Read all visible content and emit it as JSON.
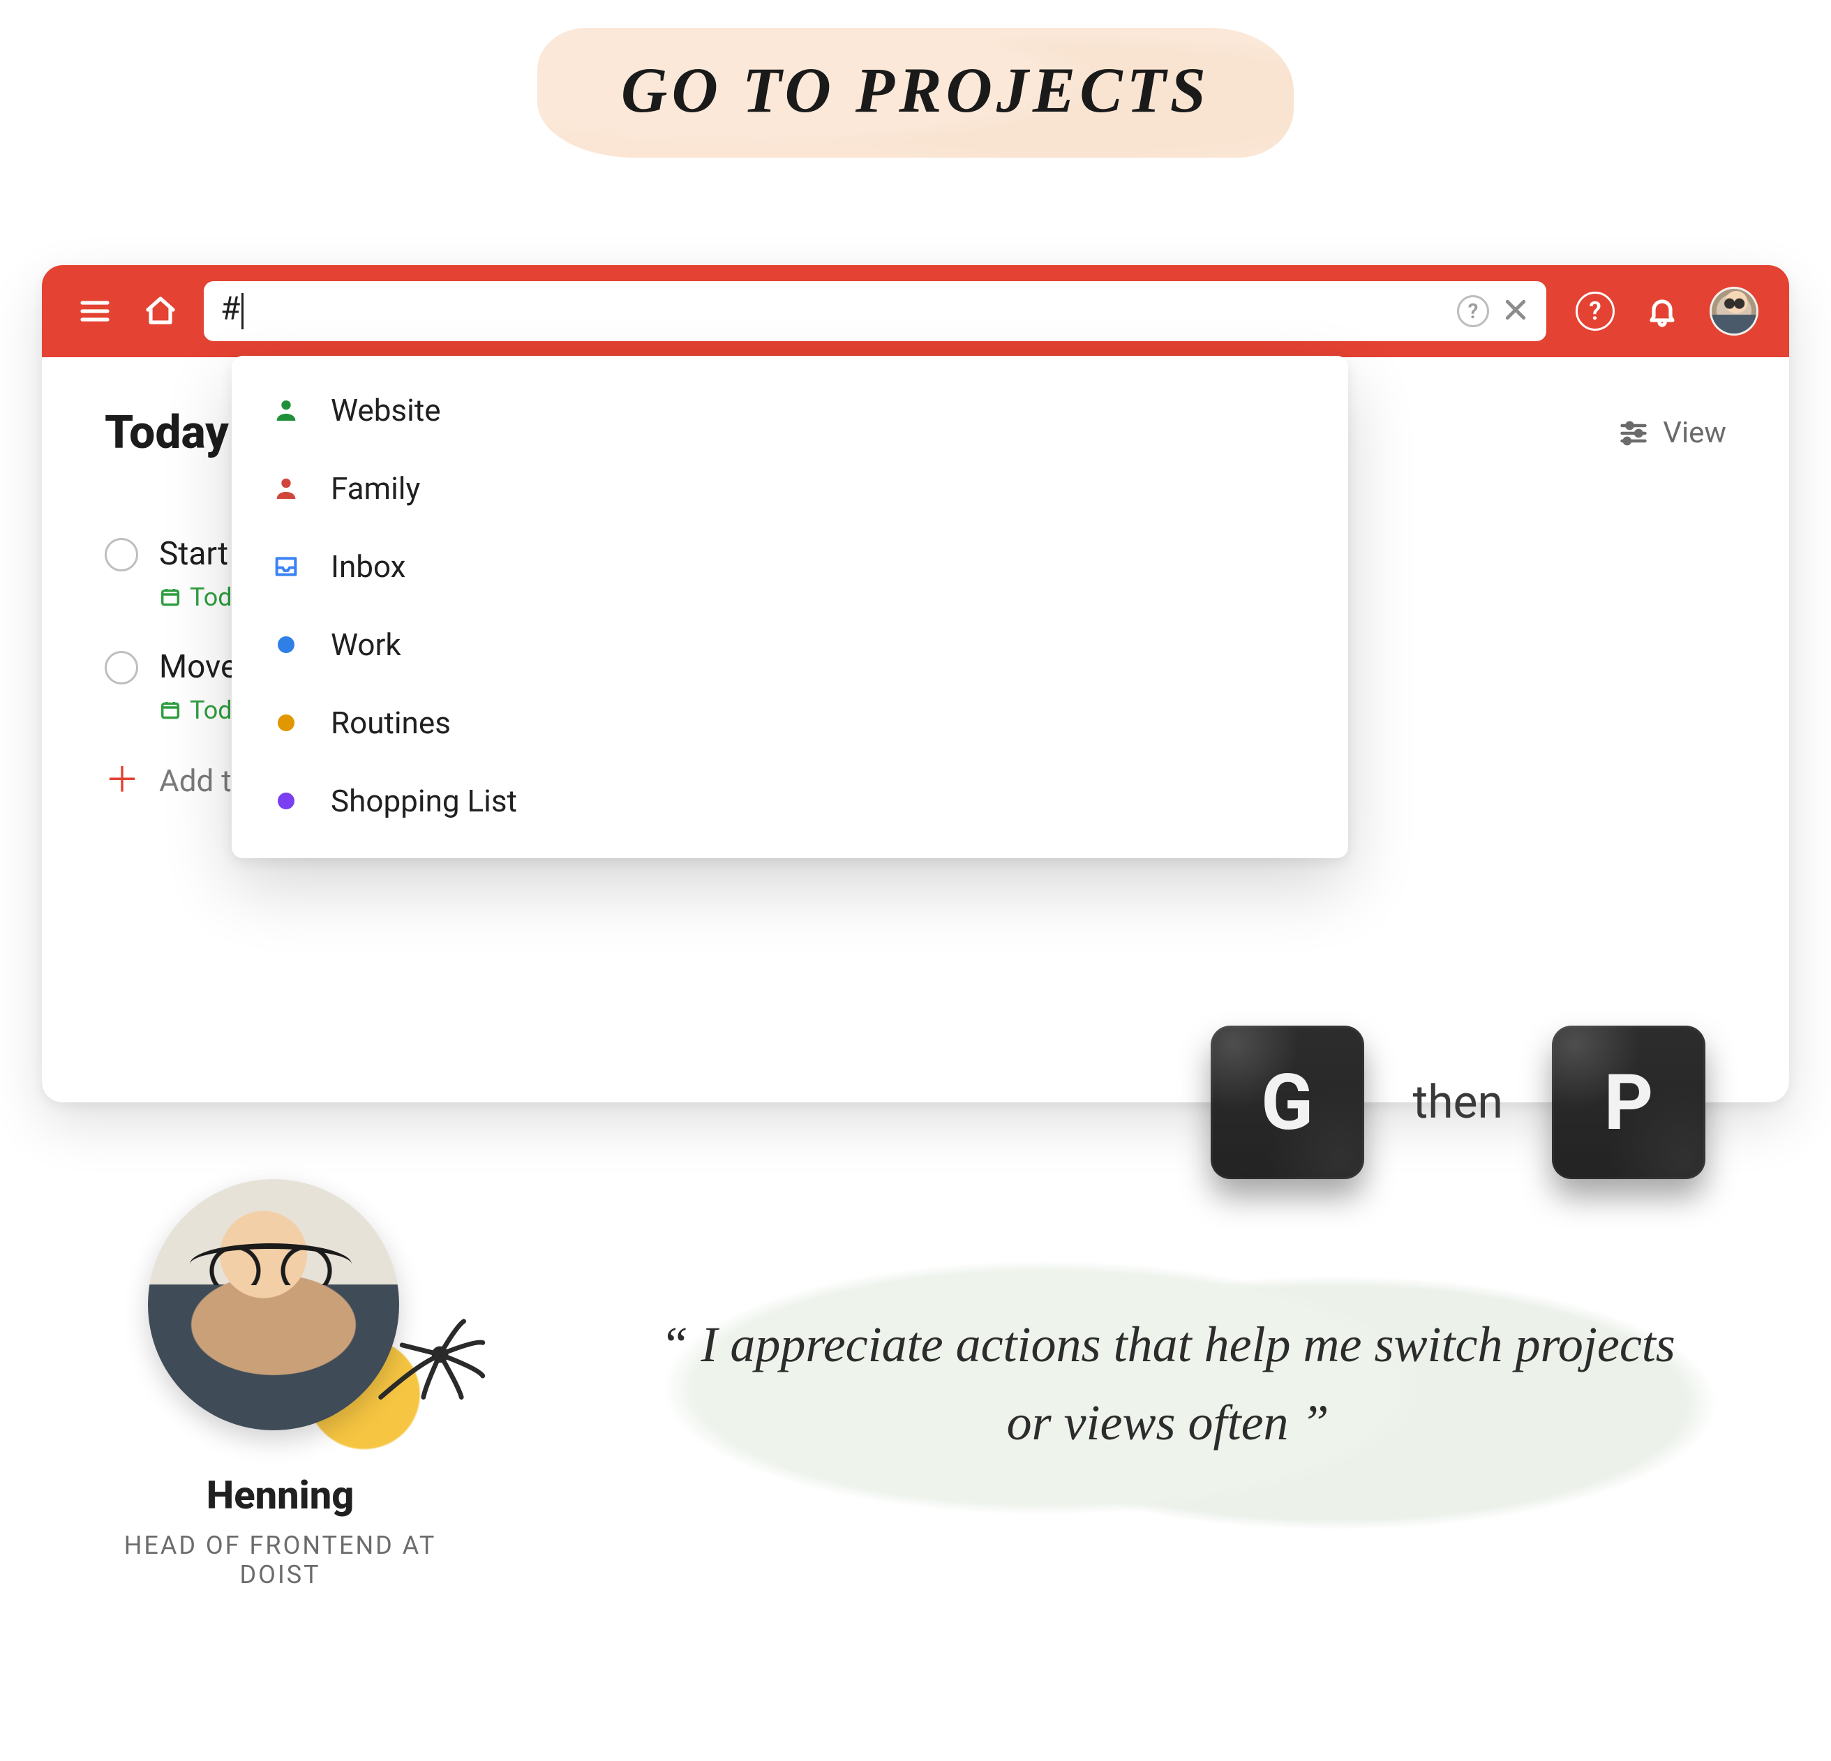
{
  "title": "GO TO PROJECTS",
  "search": {
    "value": "#"
  },
  "page": {
    "heading": "Today",
    "view_label": "View"
  },
  "tasks": [
    {
      "title": "Start l",
      "date_label": "Toda"
    },
    {
      "title": "Move",
      "date_label": "Toda"
    }
  ],
  "add_task_label": "Add task",
  "popover": {
    "items": [
      {
        "label": "Website",
        "icon": "person",
        "color": "#1f8f3a"
      },
      {
        "label": "Family",
        "icon": "person",
        "color": "#d1453b"
      },
      {
        "label": "Inbox",
        "icon": "inbox",
        "color": "#3b82f6"
      },
      {
        "label": "Work",
        "icon": "dot",
        "color": "#2f7fe6"
      },
      {
        "label": "Routines",
        "icon": "dot",
        "color": "#e19700"
      },
      {
        "label": "Shopping List",
        "icon": "dot",
        "color": "#7b3ff2"
      }
    ]
  },
  "shortcut": {
    "key1": "G",
    "joiner": "then",
    "key2": "P"
  },
  "testimonial": {
    "name": "Henning",
    "role": "HEAD OF FRONTEND AT DOIST",
    "quote": "“ I appreciate actions that help me switch projects or views often ”"
  }
}
